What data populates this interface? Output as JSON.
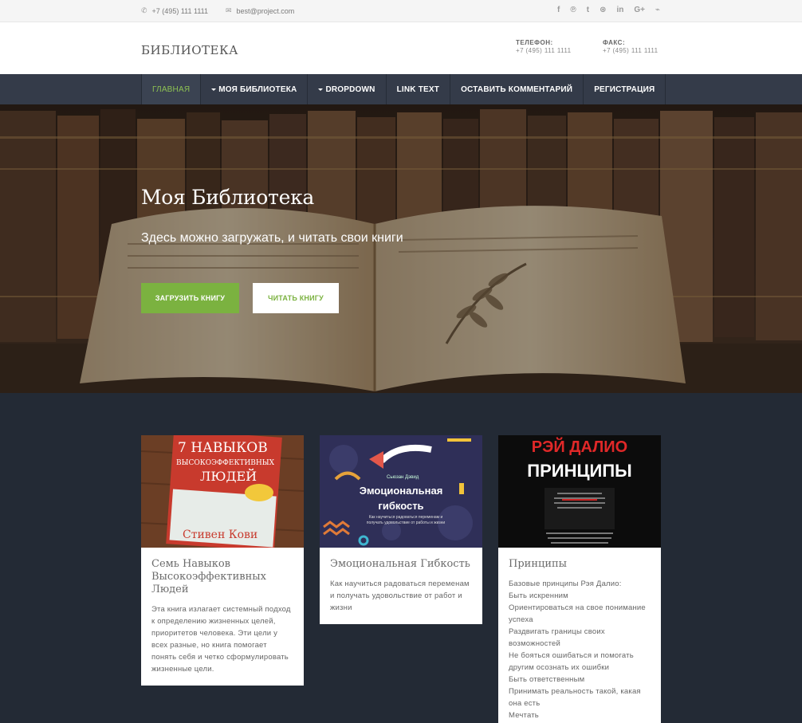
{
  "topbar": {
    "phone": "+7 (495) 111 1111",
    "email": "best@project.com",
    "social_icons": [
      "facebook-icon",
      "pinterest-icon",
      "twitter-icon",
      "dribbble-icon",
      "linkedin-icon",
      "googleplus-icon",
      "rss-icon"
    ],
    "social_glyphs": [
      "f",
      "℗",
      "t",
      "⊛",
      "in",
      "G+",
      "⌁"
    ]
  },
  "header": {
    "brand": "БИБЛИОТЕКА",
    "phone_label": "ТЕЛЕФОН:",
    "phone_value": "+7 (495) 111 1111",
    "fax_label": "ФАКС:",
    "fax_value": "+7 (495) 111 1111"
  },
  "nav": {
    "items": [
      {
        "label": "ГЛАВНАЯ"
      },
      {
        "label": "МОЯ БИБЛИОТЕКА"
      },
      {
        "label": "DROPDOWN"
      },
      {
        "label": "LINK TEXT"
      },
      {
        "label": "ОСТАВИТЬ КОММЕНТАРИЙ"
      },
      {
        "label": "РЕГИСТРАЦИЯ"
      }
    ]
  },
  "hero": {
    "title": "Моя Библиотека",
    "subtitle": "Здесь можно загружать, и читать свои книги",
    "primary_button": "ЗАГРУЗИТЬ КНИГУ",
    "secondary_button": "ЧИТАТЬ КНИГУ"
  },
  "books": [
    {
      "cover_top": "7 НАВЫКОВ",
      "cover_mid": "ВЫСОКОЭФФЕКТИВНЫХ",
      "cover_low": "ЛЮДЕЙ",
      "cover_author": "Стивен Кови",
      "title": "Семь Навыков Высокоэффективных Людей",
      "text": "Эта книга излагает системный подход к определению жизненных целей, приоритетов человека. Эти цели у всех разные, но книга помогает понять себя и четко сформулировать жизненные цели."
    },
    {
      "cover_author": "Сьюзан Дэвид",
      "cover_title": "Эмоциональная гибкость",
      "cover_sub": "Как научиться радоваться переменам и получать удовольствие от работы и жизни",
      "title": "Эмоциональная Гибкость",
      "text": "Как научиться радоваться переменам и получать удовольствие от работ и жизни"
    },
    {
      "cover_author": "РЭЙ ДАЛИО",
      "cover_title": "ПРИНЦИПЫ",
      "title": "Принципы",
      "lines": [
        "Базовые принципы Рэя Далио:",
        "Быть искренним",
        "Ориентироваться на свое понимание успеха",
        "Раздвигать границы своих возможностей",
        "Не бояться ошибаться и помогать другим осознать их ошибки",
        "Быть ответственным",
        "Принимать реальность такой, какая она есть",
        "Мечтать"
      ]
    }
  ],
  "colors": {
    "accent": "#7bb240",
    "nav_bg": "#343b49",
    "page_bg": "#232a35"
  }
}
